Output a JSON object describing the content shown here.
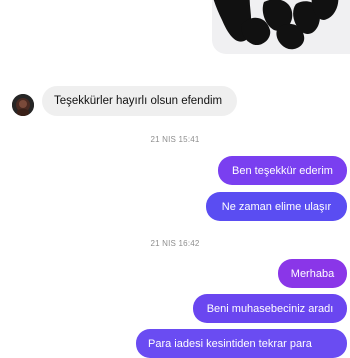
{
  "conversation": {
    "top_image": {
      "icon": "photo-attachment"
    },
    "incoming": [
      {
        "text": "Teşekkürler hayırlı olsun efendim",
        "avatar": "contact-avatar"
      }
    ],
    "timestamps": [
      "21 NIS 15:41",
      "21 NIS 16:42"
    ],
    "outgoing": [
      {
        "text": "Ben teşekkür ederim"
      },
      {
        "text": "Ne zaman elime ulaşır"
      },
      {
        "text": "Merhaba"
      },
      {
        "text": "Beni muhasebeciniz aradı"
      },
      {
        "text": "Para iadesi kesintiden tekrar para"
      }
    ]
  },
  "colors": {
    "incoming_bubble": "#efefef",
    "outgoing_gradient": [
      "#8a36e8",
      "#5a4df2"
    ],
    "timestamp_text": "#8e8e8e"
  }
}
